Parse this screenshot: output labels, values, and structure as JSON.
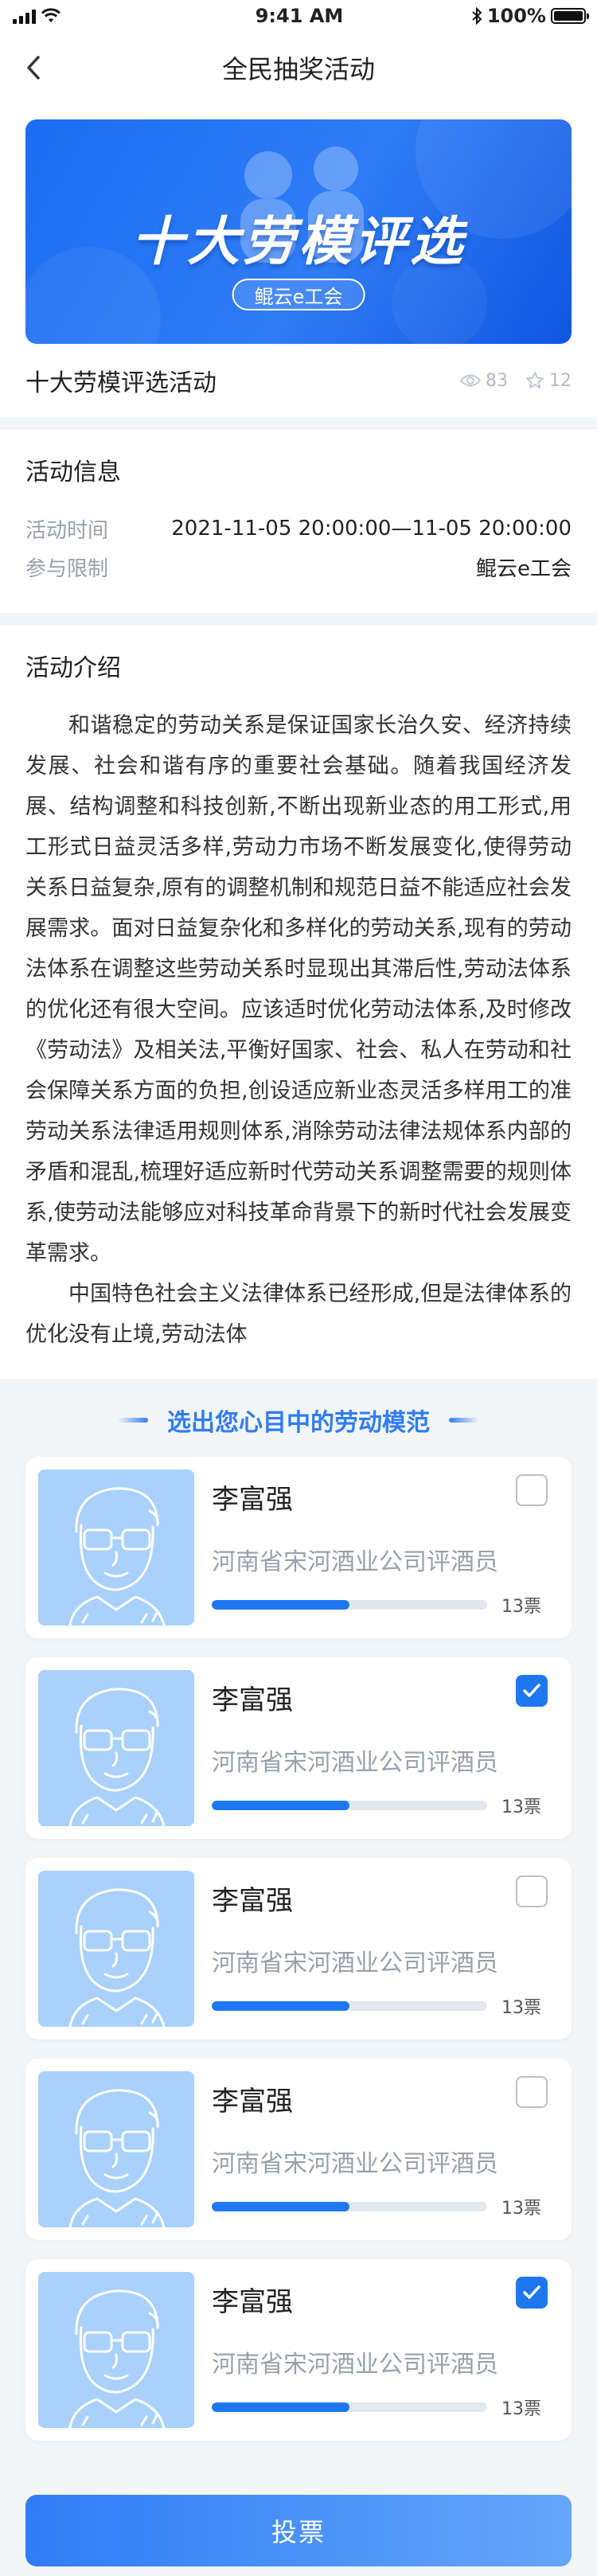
{
  "status_bar": {
    "time": "9:41 AM",
    "battery": "100%",
    "battery_level": 1.0
  },
  "nav": {
    "title": "全民抽奖活动",
    "back_icon": "chevron-left-icon"
  },
  "banner": {
    "title": "十大劳模评选",
    "badge": "鲲云e工会"
  },
  "activity": {
    "title": "十大劳模评选活动",
    "views": "83",
    "favorites": "12",
    "view_icon": "eye-icon",
    "fav_icon": "star-icon"
  },
  "info": {
    "heading": "活动信息",
    "time_label": "活动时间",
    "time_value": "2021-11-05 20:00:00—11-05 20:00:00",
    "limit_label": "参与限制",
    "limit_value": "鲲云e工会"
  },
  "intro": {
    "heading": "活动介绍",
    "paragraphs": [
      "和谐稳定的劳动关系是保证国家长治久安、经济持续发展、社会和谐有序的重要社会基础。随着我国经济发展、结构调整和科技创新,不断出现新业态的用工形式,用工形式日益灵活多样,劳动力市场不断发展变化,使得劳动关系日益复杂,原有的调整机制和规范日益不能适应社会发展需求。面对日益复杂化和多样化的劳动关系,现有的劳动法体系在调整这些劳动关系时显现出其滞后性,劳动法体系的优化还有很大空间。应该适时优化劳动法体系,及时修改《劳动法》及相关法,平衡好国家、社会、私人在劳动和社会保障关系方面的负担,创设适应新业态灵活多样用工的准劳动关系法律适用规则体系,消除劳动法律法规体系内部的矛盾和混乱,梳理好适应新时代劳动关系调整需要的规则体系,使劳动法能够应对科技革命背景下的新时代社会发展变革需求。",
      "中国特色社会主义法律体系已经形成,但是法律体系的优化没有止境,劳动法体"
    ]
  },
  "vote": {
    "heading": "选出您心目中的劳动模范",
    "candidates": [
      {
        "name": "李富强",
        "title": "河南省宋河酒业公司评酒员",
        "votes": "13票",
        "progress": 0.5,
        "checked": false
      },
      {
        "name": "李富强",
        "title": "河南省宋河酒业公司评酒员",
        "votes": "13票",
        "progress": 0.5,
        "checked": true
      },
      {
        "name": "李富强",
        "title": "河南省宋河酒业公司评酒员",
        "votes": "13票",
        "progress": 0.5,
        "checked": false
      },
      {
        "name": "李富强",
        "title": "河南省宋河酒业公司评酒员",
        "votes": "13票",
        "progress": 0.5,
        "checked": false
      },
      {
        "name": "李富强",
        "title": "河南省宋河酒业公司评酒员",
        "votes": "13票",
        "progress": 0.5,
        "checked": true
      }
    ],
    "submit_label": "投票"
  },
  "colors": {
    "accent": "#1f77f0",
    "banner": "#2f7cf6",
    "avatar_bg": "#a9d1fb"
  }
}
